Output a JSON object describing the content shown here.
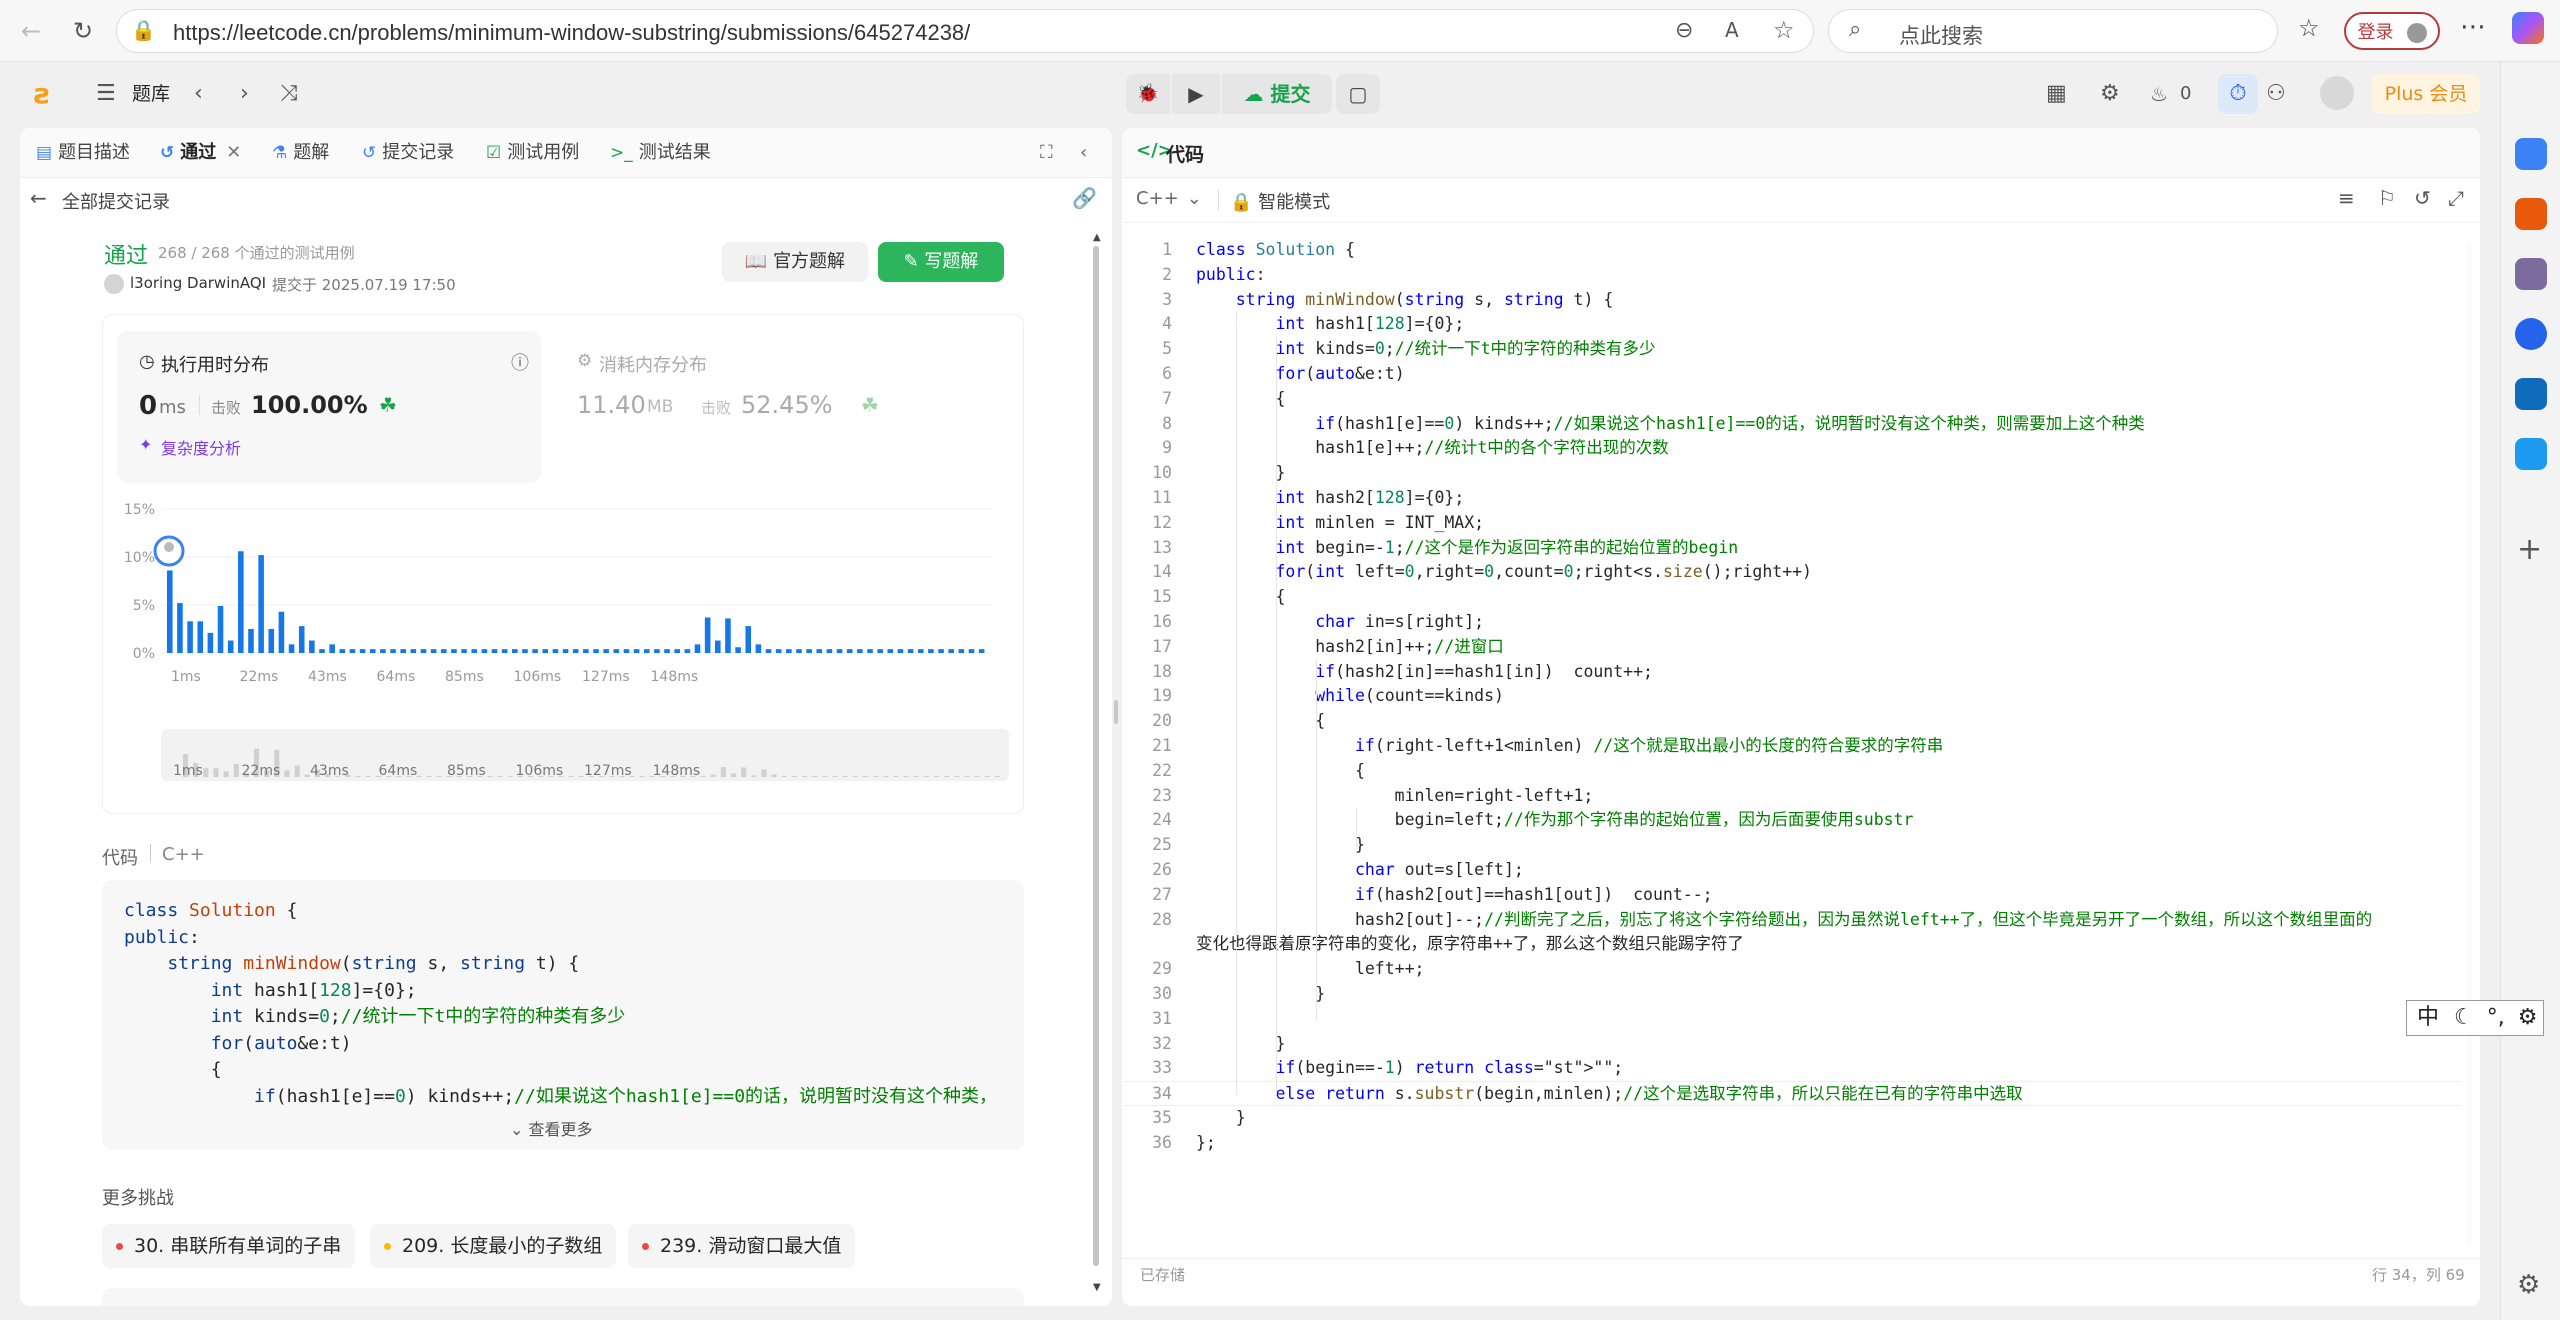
{
  "browser": {
    "url": "https://leetcode.cn/problems/minimum-window-substring/submissions/645274238/",
    "search_placeholder": "点此搜索",
    "login_label": "登录"
  },
  "header": {
    "library_label": "题库",
    "submit_label": "提交",
    "streak_count": "0",
    "plus_label": "Plus 会员"
  },
  "left_tabs": [
    {
      "label": "题目描述"
    },
    {
      "label": "通过"
    },
    {
      "label": "题解"
    },
    {
      "label": "提交记录"
    },
    {
      "label": "测试用例"
    },
    {
      "label": "测试结果"
    }
  ],
  "back_label": "全部提交记录",
  "result": {
    "status": "通过",
    "cases": "268 / 268 个通过的测试用例",
    "user": "l3oring DarwinAQI",
    "submitted_at": "提交于 2025.07.19 17:50",
    "official_solution_label": "官方题解",
    "write_solution_label": "写题解"
  },
  "runtime": {
    "title": "执行用时分布",
    "value": "0",
    "unit": "ms",
    "beats_label": "击败",
    "beats": "100.00%",
    "complexity_label": "复杂度分析"
  },
  "memory": {
    "title": "消耗内存分布",
    "value": "11.40",
    "unit": "MB",
    "beats_label": "击败",
    "beats": "52.45%"
  },
  "chart_data": {
    "type": "bar",
    "ylabel_ticks": [
      "15%",
      "10%",
      "5%",
      "0%"
    ],
    "ylim": [
      0,
      15
    ],
    "x_tick_labels": [
      "1ms",
      "22ms",
      "43ms",
      "64ms",
      "85ms",
      "106ms",
      "127ms",
      "148ms"
    ],
    "values": [
      8.6,
      5.2,
      3.3,
      3.3,
      2.1,
      4.9,
      1.3,
      10.6,
      2.5,
      10.2,
      2.5,
      4.3,
      0.9,
      2.8,
      1.3,
      0.4,
      0.9,
      0.4,
      0.4,
      0.4,
      0.4,
      0.4,
      0.4,
      0.4,
      0.4,
      0.4,
      0.4,
      0.4,
      0.4,
      0.4,
      0.4,
      0.4,
      0.4,
      0.4,
      0.4,
      0.4,
      0.4,
      0.4,
      0.4,
      0.4,
      0.4,
      0.4,
      0.4,
      0.4,
      0.4,
      0.4,
      0.4,
      0.4,
      0.4,
      0.4,
      0.4,
      0.4,
      0.9,
      3.7,
      1.3,
      3.6,
      0.6,
      2.8,
      0.9,
      0.4,
      0.4,
      0.4,
      0.4,
      0.4,
      0.4,
      0.4,
      0.4,
      0.4,
      0.4,
      0.4,
      0.4,
      0.4,
      0.4,
      0.4,
      0.4,
      0.4,
      0.4,
      0.4,
      0.4,
      0.4,
      0.4
    ],
    "grid": true,
    "accent": "#1677e8"
  },
  "code_preview": {
    "label": "代码",
    "lang": "C++",
    "lines": [
      "class Solution {",
      "public:",
      "    string minWindow(string s, string t) {",
      "        int hash1[128]={0};",
      "        int kinds=0;//统计一下t中的字符的种类有多少",
      "        for(auto&e:t)",
      "        {",
      "            if(hash1[e]==0) kinds++;//如果说这个hash1[e]==0的话，说明暂时没有这个种类，"
    ],
    "more_label": "查看更多"
  },
  "challenges": {
    "title": "更多挑战",
    "items": [
      {
        "label": "30. 串联所有单词的子串",
        "color": "#ef4743"
      },
      {
        "label": "209. 长度最小的子数组",
        "color": "#ffb800"
      },
      {
        "label": "239. 滑动窗口最大值",
        "color": "#ef4743"
      }
    ]
  },
  "editor": {
    "title": "代码",
    "lang": "C++",
    "mode": "智能模式",
    "saved": "已存储",
    "cursor": "行 34，列 69",
    "lines": [
      {
        "n": "1",
        "t": "class Solution {"
      },
      {
        "n": "2",
        "t": "public:"
      },
      {
        "n": "3",
        "t": "    string minWindow(string s, string t) {"
      },
      {
        "n": "4",
        "t": "        int hash1[128]={0};"
      },
      {
        "n": "5",
        "t": "        int kinds=0;//统计一下t中的字符的种类有多少"
      },
      {
        "n": "6",
        "t": "        for(auto&e:t)"
      },
      {
        "n": "7",
        "t": "        {"
      },
      {
        "n": "8",
        "t": "            if(hash1[e]==0) kinds++;//如果说这个hash1[e]==0的话，说明暂时没有这个种类，则需要加上这个种类"
      },
      {
        "n": "9",
        "t": "            hash1[e]++;//统计t中的各个字符出现的次数"
      },
      {
        "n": "10",
        "t": "        }"
      },
      {
        "n": "11",
        "t": "        int hash2[128]={0};"
      },
      {
        "n": "12",
        "t": "        int minlen = INT_MAX;"
      },
      {
        "n": "13",
        "t": "        int begin=-1;//这个是作为返回字符串的起始位置的begin"
      },
      {
        "n": "14",
        "t": "        for(int left=0,right=0,count=0;right<s.size();right++)"
      },
      {
        "n": "15",
        "t": "        {"
      },
      {
        "n": "16",
        "t": "            char in=s[right];"
      },
      {
        "n": "17",
        "t": "            hash2[in]++;//进窗口"
      },
      {
        "n": "18",
        "t": "            if(hash2[in]==hash1[in])  count++;"
      },
      {
        "n": "19",
        "t": "            while(count==kinds)"
      },
      {
        "n": "20",
        "t": "            {"
      },
      {
        "n": "21",
        "t": "                if(right-left+1<minlen) //这个就是取出最小的长度的符合要求的字符串"
      },
      {
        "n": "22",
        "t": "                {"
      },
      {
        "n": "23",
        "t": "                    minlen=right-left+1;"
      },
      {
        "n": "24",
        "t": "                    begin=left;//作为那个字符串的起始位置，因为后面要使用substr"
      },
      {
        "n": "25",
        "t": "                }"
      },
      {
        "n": "26",
        "t": "                char out=s[left];"
      },
      {
        "n": "27",
        "t": "                if(hash2[out]==hash1[out])  count--;"
      },
      {
        "n": "28",
        "t": "                hash2[out]--;//判断完了之后，别忘了将这个字符给题出，因为虽然说left++了，但这个毕竟是另开了一个数组，所以这个数组里面的"
      },
      {
        "n": "",
        "t": "变化也得跟着原字符串的变化，原字符串++了，那么这个数组只能踢字符了"
      },
      {
        "n": "29",
        "t": "                left++;"
      },
      {
        "n": "30",
        "t": "            }"
      },
      {
        "n": "31",
        "t": ""
      },
      {
        "n": "32",
        "t": "        }"
      },
      {
        "n": "33",
        "t": "        if(begin==-1) return \"\";"
      },
      {
        "n": "34",
        "t": "        else return s.substr(begin,minlen);//这个是选取字符串，所以只能在已有的字符串中选取"
      },
      {
        "n": "35",
        "t": "    }"
      },
      {
        "n": "36",
        "t": "};"
      }
    ]
  },
  "ime": {
    "label": "中"
  }
}
